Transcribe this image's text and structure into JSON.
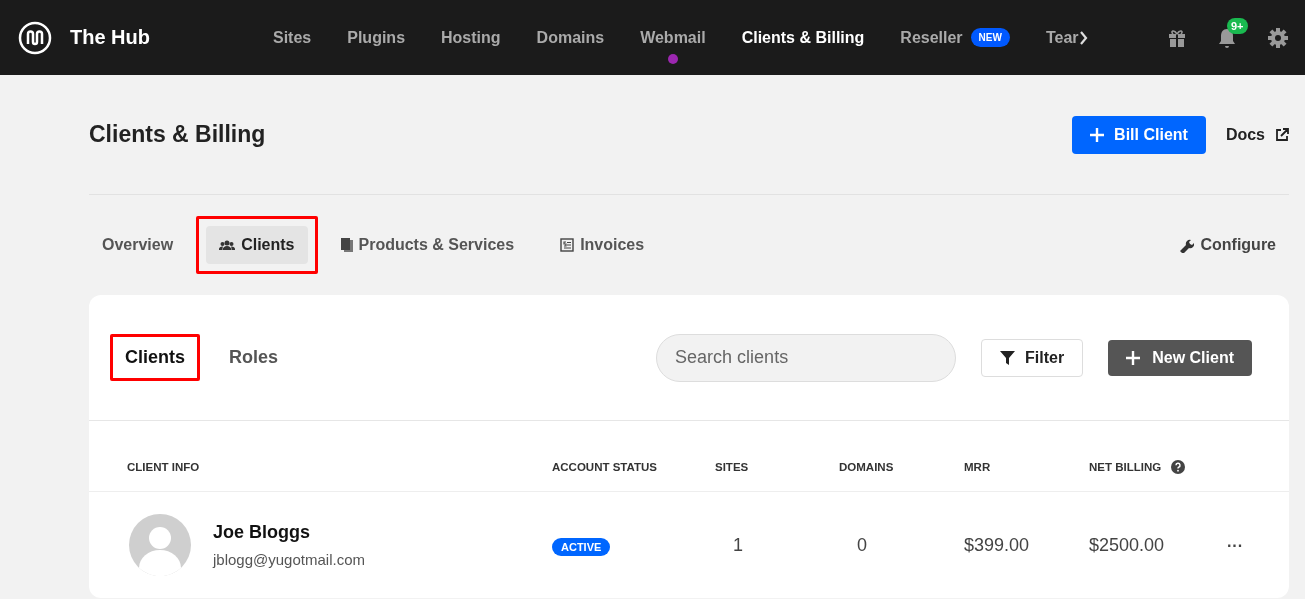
{
  "brand": {
    "title": "The Hub"
  },
  "nav": [
    {
      "label": "Sites",
      "selected": false,
      "dot": false
    },
    {
      "label": "Plugins",
      "selected": false,
      "dot": false
    },
    {
      "label": "Hosting",
      "selected": false,
      "dot": false
    },
    {
      "label": "Domains",
      "selected": false,
      "dot": false
    },
    {
      "label": "Webmail",
      "selected": false,
      "dot": true
    },
    {
      "label": "Clients & Billing",
      "selected": true,
      "dot": false
    },
    {
      "label": "Reseller",
      "selected": false,
      "dot": false,
      "badge": "NEW"
    },
    {
      "label": "Tear",
      "selected": false,
      "dot": false
    }
  ],
  "notifications": {
    "badge": "9+"
  },
  "page": {
    "title": "Clients & Billing",
    "primary_button": "Bill Client",
    "docs_link": "Docs"
  },
  "tabs": [
    {
      "label": "Overview",
      "selected": false,
      "highlighted": false
    },
    {
      "label": "Clients",
      "selected": true,
      "highlighted": true
    },
    {
      "label": "Products & Services",
      "selected": false,
      "highlighted": false
    },
    {
      "label": "Invoices",
      "selected": false,
      "highlighted": false
    }
  ],
  "configure": "Configure",
  "subtabs": [
    {
      "label": "Clients",
      "selected": true,
      "highlighted": true
    },
    {
      "label": "Roles",
      "selected": false,
      "highlighted": false
    }
  ],
  "search": {
    "placeholder": "Search clients"
  },
  "filter_button": "Filter",
  "new_button": "New Client",
  "table": {
    "columns": [
      "CLIENT INFO",
      "ACCOUNT STATUS",
      "SITES",
      "DOMAINS",
      "MRR",
      "NET BILLING"
    ],
    "rows": [
      {
        "name": "Joe Bloggs",
        "email": "jblogg@yugotmail.com",
        "status": "ACTIVE",
        "sites": "1",
        "domains": "0",
        "mrr": "$399.00",
        "net_billing": "$2500.00",
        "menu": "···"
      }
    ]
  }
}
